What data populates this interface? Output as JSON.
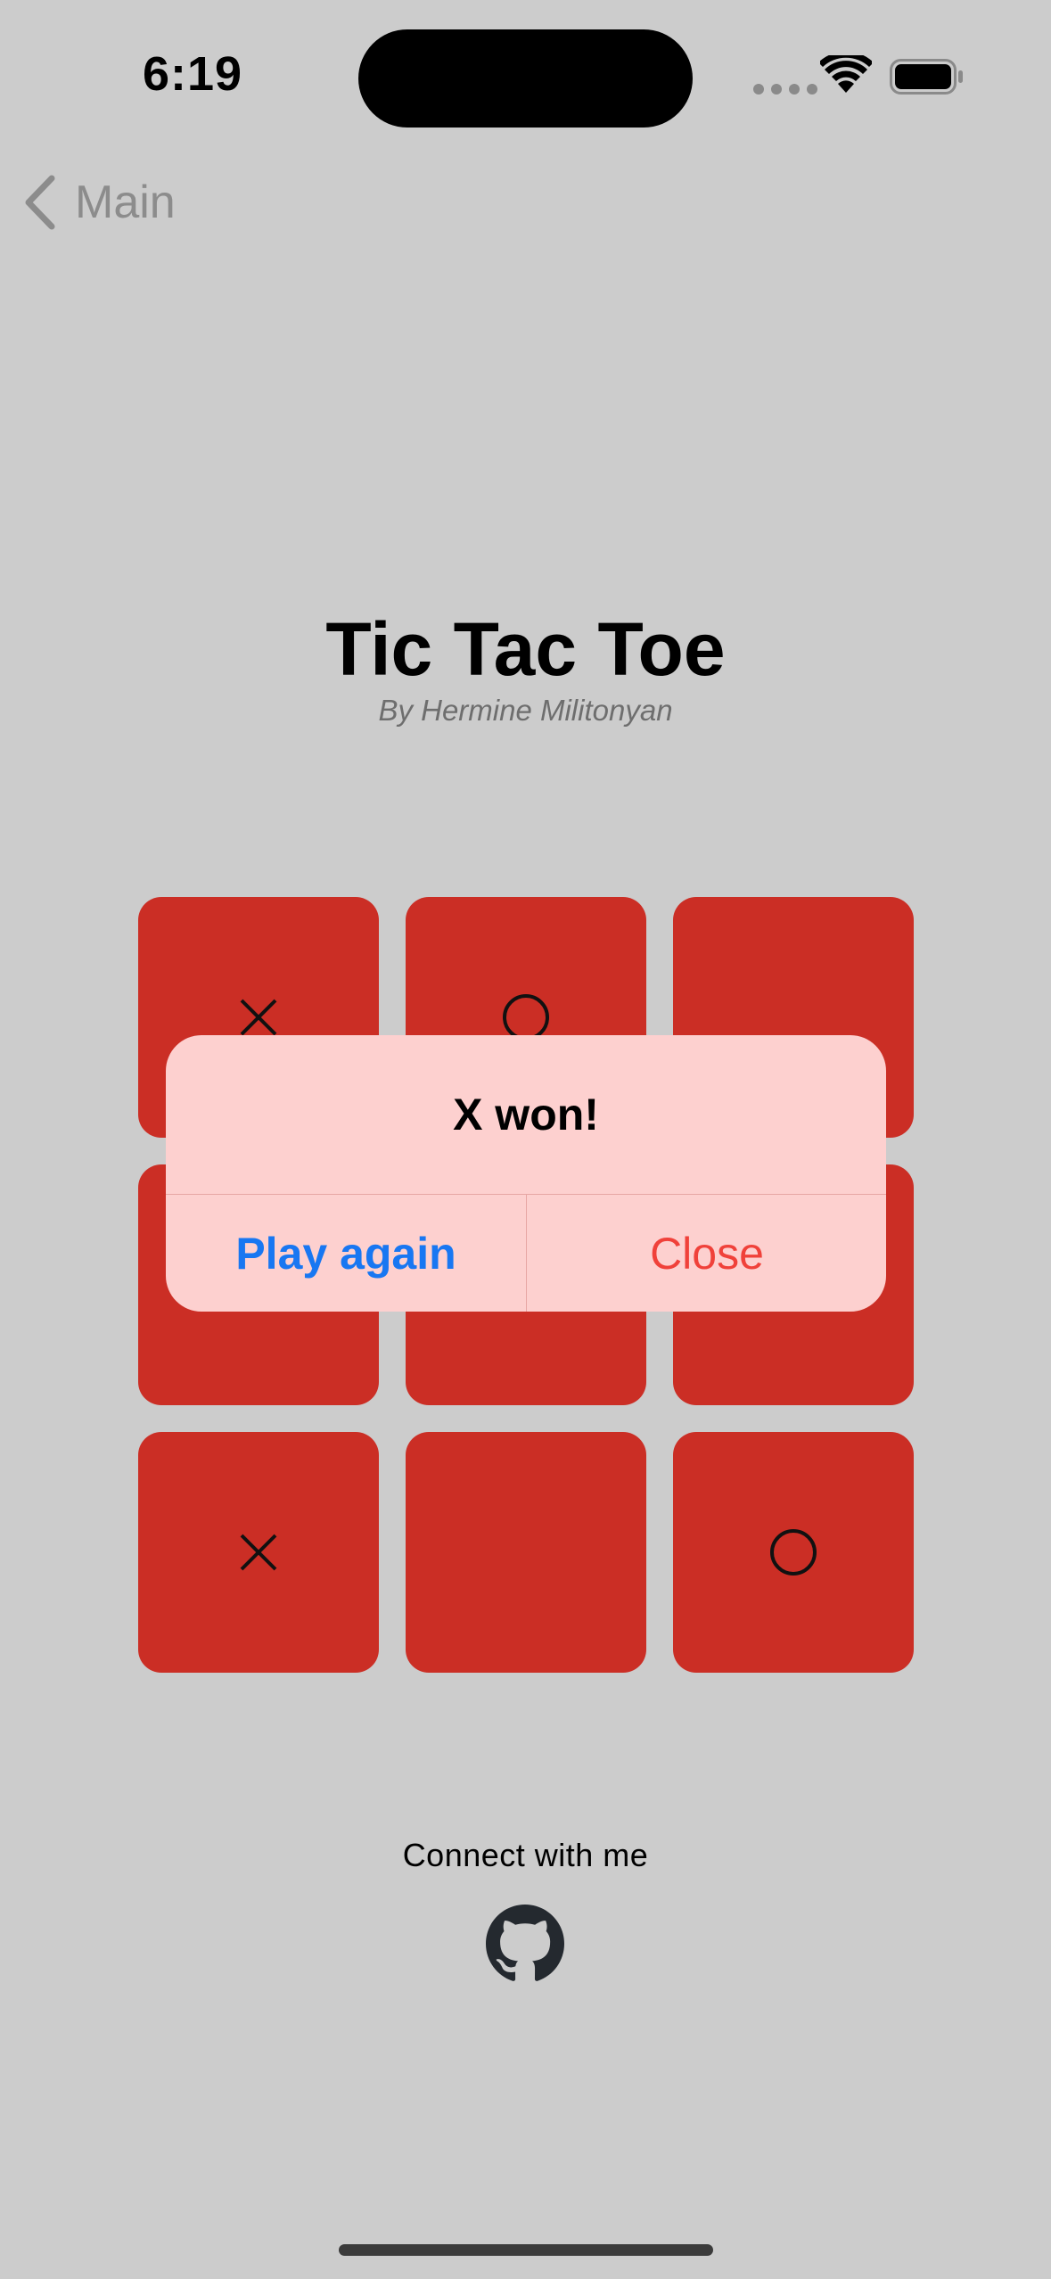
{
  "status_bar": {
    "time": "6:19"
  },
  "nav": {
    "back_label": "Main",
    "back_icon": "chevron-left-icon"
  },
  "header": {
    "title": "Tic Tac Toe",
    "subtitle": "By Hermine Militonyan"
  },
  "board": {
    "cells": [
      "X",
      "O",
      "",
      "",
      "",
      "",
      "X",
      "",
      "O"
    ],
    "cell_color": "#cb2e25"
  },
  "alert": {
    "title": "X won!",
    "primary_button": "Play again",
    "secondary_button": "Close",
    "primary_color": "#1877f2",
    "secondary_color": "#f0413a"
  },
  "footer": {
    "connect_label": "Connect with me",
    "social_icon": "github-icon"
  },
  "colors": {
    "background": "#cccccc",
    "alert_background": "#fdd0cf"
  }
}
